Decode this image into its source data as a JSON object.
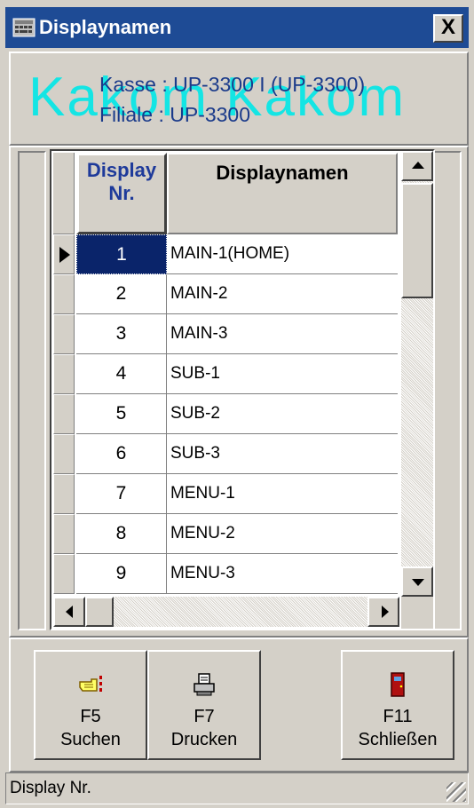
{
  "window": {
    "title": "Displaynamen",
    "close_label": "X"
  },
  "header": {
    "watermark": "Kakom Kakom",
    "kasse": "Kasse : UP-3300 I (UP-3300)",
    "filiale": "Filiale : UP-3300"
  },
  "grid": {
    "columns": [
      "Display\nNr.",
      "Displaynamen"
    ],
    "col_nr_line1": "Display",
    "col_nr_line2": "Nr.",
    "col_name": "Displaynamen",
    "selected_row": 0,
    "rows": [
      {
        "nr": "1",
        "name": "MAIN-1(HOME)"
      },
      {
        "nr": "2",
        "name": "MAIN-2"
      },
      {
        "nr": "3",
        "name": "MAIN-3"
      },
      {
        "nr": "4",
        "name": "SUB-1"
      },
      {
        "nr": "5",
        "name": "SUB-2"
      },
      {
        "nr": "6",
        "name": "SUB-3"
      },
      {
        "nr": "7",
        "name": "MENU-1"
      },
      {
        "nr": "8",
        "name": "MENU-2"
      },
      {
        "nr": "9",
        "name": "MENU-3"
      }
    ]
  },
  "buttons": {
    "search": {
      "key": "F5",
      "label": "Suchen",
      "icon": "pointing-hand-icon"
    },
    "print": {
      "key": "F7",
      "label": "Drucken",
      "icon": "printer-icon"
    },
    "close": {
      "key": "F11",
      "label": "Schließen",
      "icon": "door-icon"
    }
  },
  "status": {
    "text": "Display Nr."
  },
  "colors": {
    "title_bg": "#1e4b95",
    "selection": "#0a246a",
    "watermark": "#00e8e8",
    "header_text": "#1a3a8a"
  }
}
